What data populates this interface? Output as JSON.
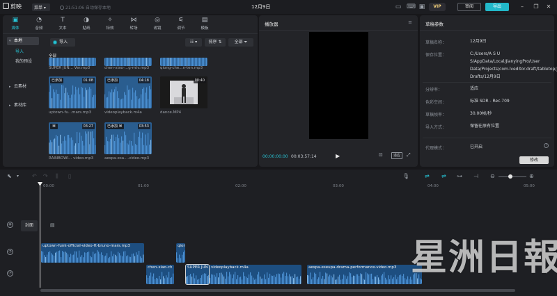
{
  "titlebar": {
    "app_name": "剪映",
    "menu_label": "菜单",
    "autosave_text": "21:51:06 自动保存本地",
    "document_title": "12月9日",
    "vip_label": "VIP",
    "share_label": "审阅",
    "export_label": "导出"
  },
  "media_toolbar": {
    "tabs": [
      {
        "label": "媒体",
        "icon": "media-icon"
      },
      {
        "label": "音频",
        "icon": "audio-icon"
      },
      {
        "label": "文本",
        "icon": "text-icon"
      },
      {
        "label": "贴纸",
        "icon": "sticker-icon"
      },
      {
        "label": "特效",
        "icon": "effects-icon"
      },
      {
        "label": "转场",
        "icon": "transition-icon"
      },
      {
        "label": "滤镜",
        "icon": "filter-icon"
      },
      {
        "label": "调节",
        "icon": "adjust-icon"
      },
      {
        "label": "模板",
        "icon": "template-icon"
      }
    ],
    "active_tab": "媒体"
  },
  "media_sidebar": {
    "local": "本地",
    "import": "导入",
    "presets": "我的预设",
    "cloud": "云素材",
    "library": "素材库"
  },
  "media_panel": {
    "import_button": "导入",
    "sort_label": "排序",
    "filter_label": "全部",
    "section_all": "全部",
    "top_row_names": [
      "SUPER JUN... Ver.mp3",
      "chen-xiao-...g-mtv.mp3",
      "qiong-che...n-ten.mp3"
    ],
    "clips": [
      {
        "name": "uptown-fu...mars.mp3",
        "added": "已添加",
        "duration": "01:08"
      },
      {
        "name": "videoplayback.m4a",
        "added": "已添加",
        "duration": "04:18"
      },
      {
        "name": "dance.MP4",
        "added": "",
        "duration": "00:40"
      },
      {
        "name": "RAINBOWI... video.mp3",
        "added": "",
        "duration": "03:27"
      },
      {
        "name": "aespa-esa....video.mp3",
        "added": "已添加",
        "duration": "03:53"
      }
    ]
  },
  "player": {
    "title": "播放器",
    "current_time": "00:00:00:00",
    "total_time": "00:03:57:14",
    "ratio_label": "适应"
  },
  "properties": {
    "title": "草稿参数",
    "rows": [
      {
        "key": "草稿名称：",
        "value": "12月9日"
      },
      {
        "key": "保存位置：",
        "value": "C:/Users/A S U S/AppData/Local/JianyingPro/User Data/Projects/com.lveditor.draft/tabletop/JianyingPro Drafts/12月9日"
      },
      {
        "key": "分辨率：",
        "value": "适应"
      },
      {
        "key": "色彩空间：",
        "value": "标准 SDR - Rec.709"
      },
      {
        "key": "草稿帧率：",
        "value": "30.00帧/秒"
      },
      {
        "key": "导入方式：",
        "value": "保留在原有位置"
      },
      {
        "key": "代理模式：",
        "value": "已开启"
      }
    ],
    "modify_button": "修改"
  },
  "timeline": {
    "ruler_labels": [
      "00:00",
      "01:00",
      "02:00",
      "03:00",
      "04:00",
      "05:00"
    ],
    "cover_label": "封面",
    "clips": [
      {
        "title": "uptown-funk-official-video-ft-bruno-mars.mp3"
      },
      {
        "title": "qion"
      },
      {
        "title": "chen-xiao-ch"
      },
      {
        "title": "SUPER JUN"
      },
      {
        "title": "videoplayback.m4a"
      },
      {
        "title": "aespa-eseupa-drama-performance-video.mp3"
      }
    ]
  },
  "watermark": "星洲日報",
  "colors": {
    "accent": "#27c3d4",
    "clip_blue": "#1d4e80",
    "background": "#17171a",
    "panel": "#232428"
  }
}
